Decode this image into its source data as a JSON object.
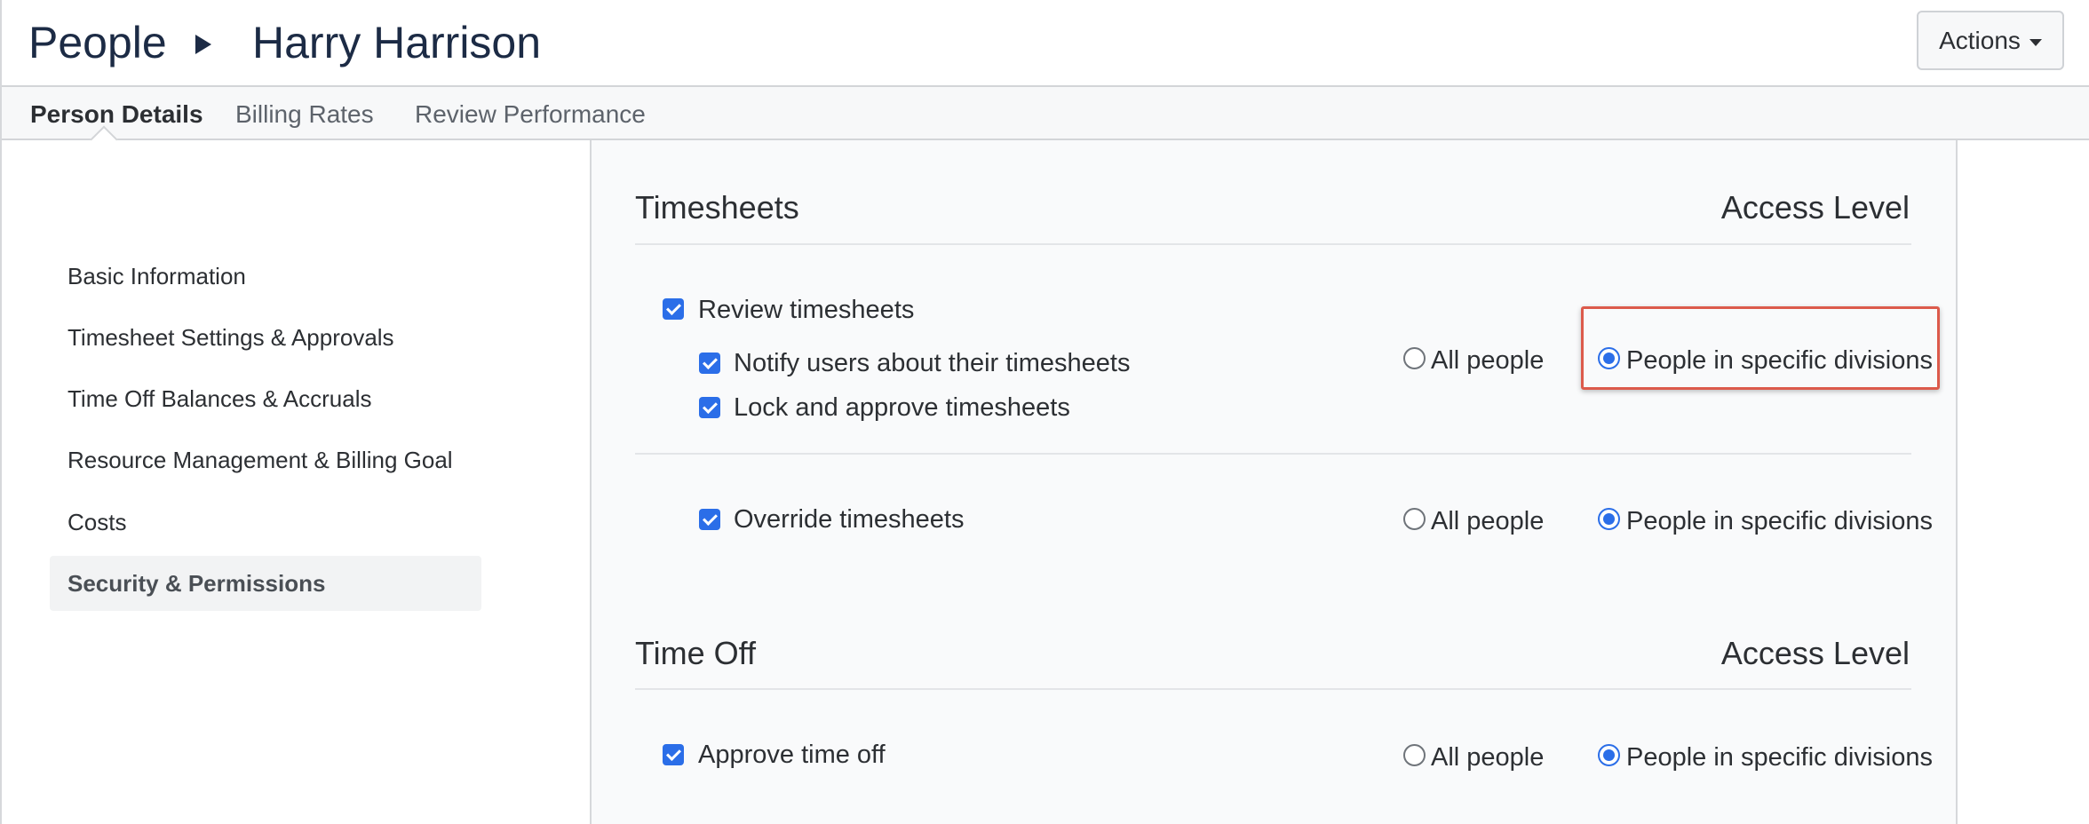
{
  "header": {
    "breadcrumb_root": "People",
    "breadcrumb_current": "Harry Harrison",
    "actions_label": "Actions"
  },
  "tabs": [
    {
      "label": "Person Details",
      "active": true
    },
    {
      "label": "Billing Rates",
      "active": false
    },
    {
      "label": "Review Performance",
      "active": false
    }
  ],
  "sidebar": {
    "items": [
      {
        "label": "Basic Information"
      },
      {
        "label": "Timesheet Settings & Approvals"
      },
      {
        "label": "Time Off Balances & Accruals"
      },
      {
        "label": "Resource Management & Billing Goal"
      },
      {
        "label": "Costs"
      },
      {
        "label": "Security & Permissions",
        "active": true
      }
    ]
  },
  "sections": {
    "timesheets": {
      "title": "Timesheets",
      "access_header": "Access Level",
      "review": {
        "label": "Review timesheets",
        "checked": true
      },
      "notify": {
        "label": "Notify users about their timesheets",
        "checked": true
      },
      "lock": {
        "label": "Lock and approve timesheets",
        "checked": true
      },
      "review_access": {
        "all": "All people",
        "specific": "People in specific divisions",
        "selected": "specific"
      },
      "override": {
        "label": "Override timesheets",
        "checked": true
      },
      "override_access": {
        "all": "All people",
        "specific": "People in specific divisions",
        "selected": "specific"
      }
    },
    "time_off": {
      "title": "Time Off",
      "access_header": "Access Level",
      "approve": {
        "label": "Approve time off",
        "checked": true
      },
      "approve_access": {
        "all": "All people",
        "specific": "People in specific divisions",
        "selected": "specific"
      }
    }
  },
  "colors": {
    "accent": "#2b6ee8",
    "highlight": "#dc5a4b",
    "title": "#1c2b45"
  }
}
